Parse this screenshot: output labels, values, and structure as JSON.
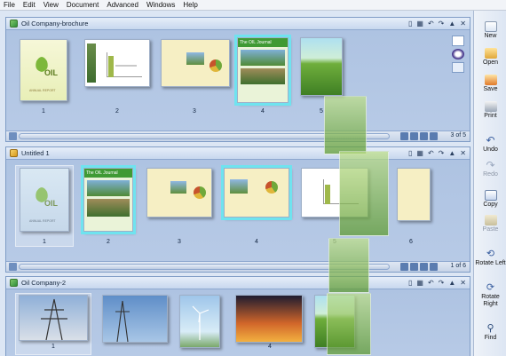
{
  "menu": [
    "File",
    "Edit",
    "View",
    "Document",
    "Advanced",
    "Windows",
    "Help"
  ],
  "documents": [
    {
      "title": "Oil Company-brochure",
      "pager": "3 of 5",
      "pages": [
        "1",
        "2",
        "3",
        "4",
        "5"
      ]
    },
    {
      "title": "Untitled 1",
      "pager": "1 of 6",
      "pages": [
        "1",
        "2",
        "3",
        "4",
        "5",
        "6"
      ]
    },
    {
      "title": "Oil Company-2",
      "pages": [
        "1",
        "",
        "",
        "4",
        ""
      ]
    }
  ],
  "page_text": {
    "oil_cover": "OIL",
    "annual_report": "ANNUAL REPORT",
    "journal": "The OIL Journal"
  },
  "toolbar": [
    {
      "label": "New",
      "icon": "new-document-icon"
    },
    {
      "label": "Open",
      "icon": "open-folder-icon"
    },
    {
      "label": "Save",
      "icon": "save-icon"
    },
    {
      "label": "Print",
      "icon": "print-icon"
    },
    {
      "label": "Undo",
      "icon": "undo-icon"
    },
    {
      "label": "Redo",
      "icon": "redo-icon"
    },
    {
      "label": "Copy",
      "icon": "copy-icon"
    },
    {
      "label": "Paste",
      "icon": "paste-icon"
    },
    {
      "label": "Rotate Left",
      "icon": "rotate-left-icon"
    },
    {
      "label": "Rotate Right",
      "icon": "rotate-right-icon"
    },
    {
      "label": "Find",
      "icon": "find-icon"
    }
  ],
  "colors": {
    "selection": "#6fe3ef",
    "accent": "#4a78b8"
  }
}
